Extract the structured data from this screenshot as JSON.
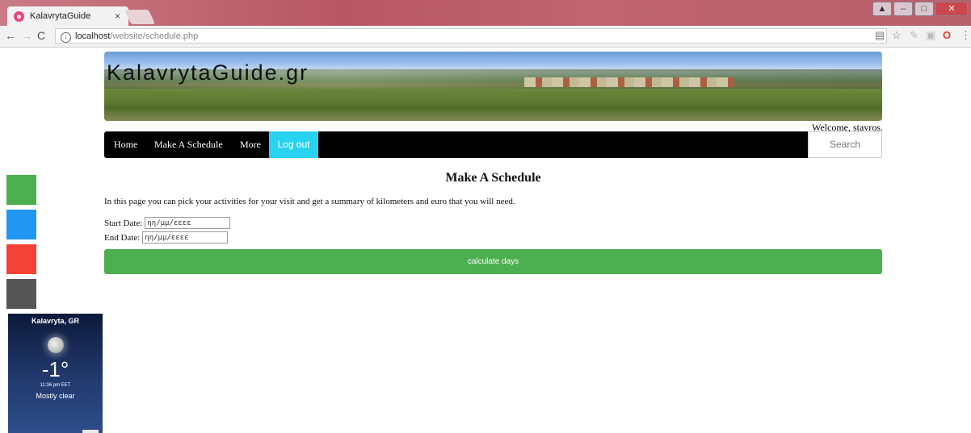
{
  "browser": {
    "tab_title": "KalavrytaGuide",
    "tab_close": "×",
    "url_host": "localhost",
    "url_path": "/website/schedule.php"
  },
  "site": {
    "banner_title": "KalavrytaGuide.gr",
    "welcome": "Welcome, stavros.",
    "nav": {
      "home": "Home",
      "make_schedule": "Make A Schedule",
      "more": "More",
      "logout": "Log out",
      "search_placeholder": "Search"
    }
  },
  "main": {
    "title": "Make A Schedule",
    "intro": "In this page you can pick your activities for your visit and get a summary of kilometers and euro that you will need.",
    "start_label": "Start Date:",
    "start_value": "ηη/μμ/εεεε",
    "end_label": "End Date:",
    "end_value": "ηη/μμ/εεεε",
    "button": "calculate days"
  },
  "share_colors": [
    "#4caf50",
    "#2196f3",
    "#f44336",
    "#555555"
  ],
  "weather": {
    "location": "Kalavryta, GR",
    "temperature": "-1°",
    "time": "11:36 pm EET",
    "condition": "Mostly clear"
  }
}
